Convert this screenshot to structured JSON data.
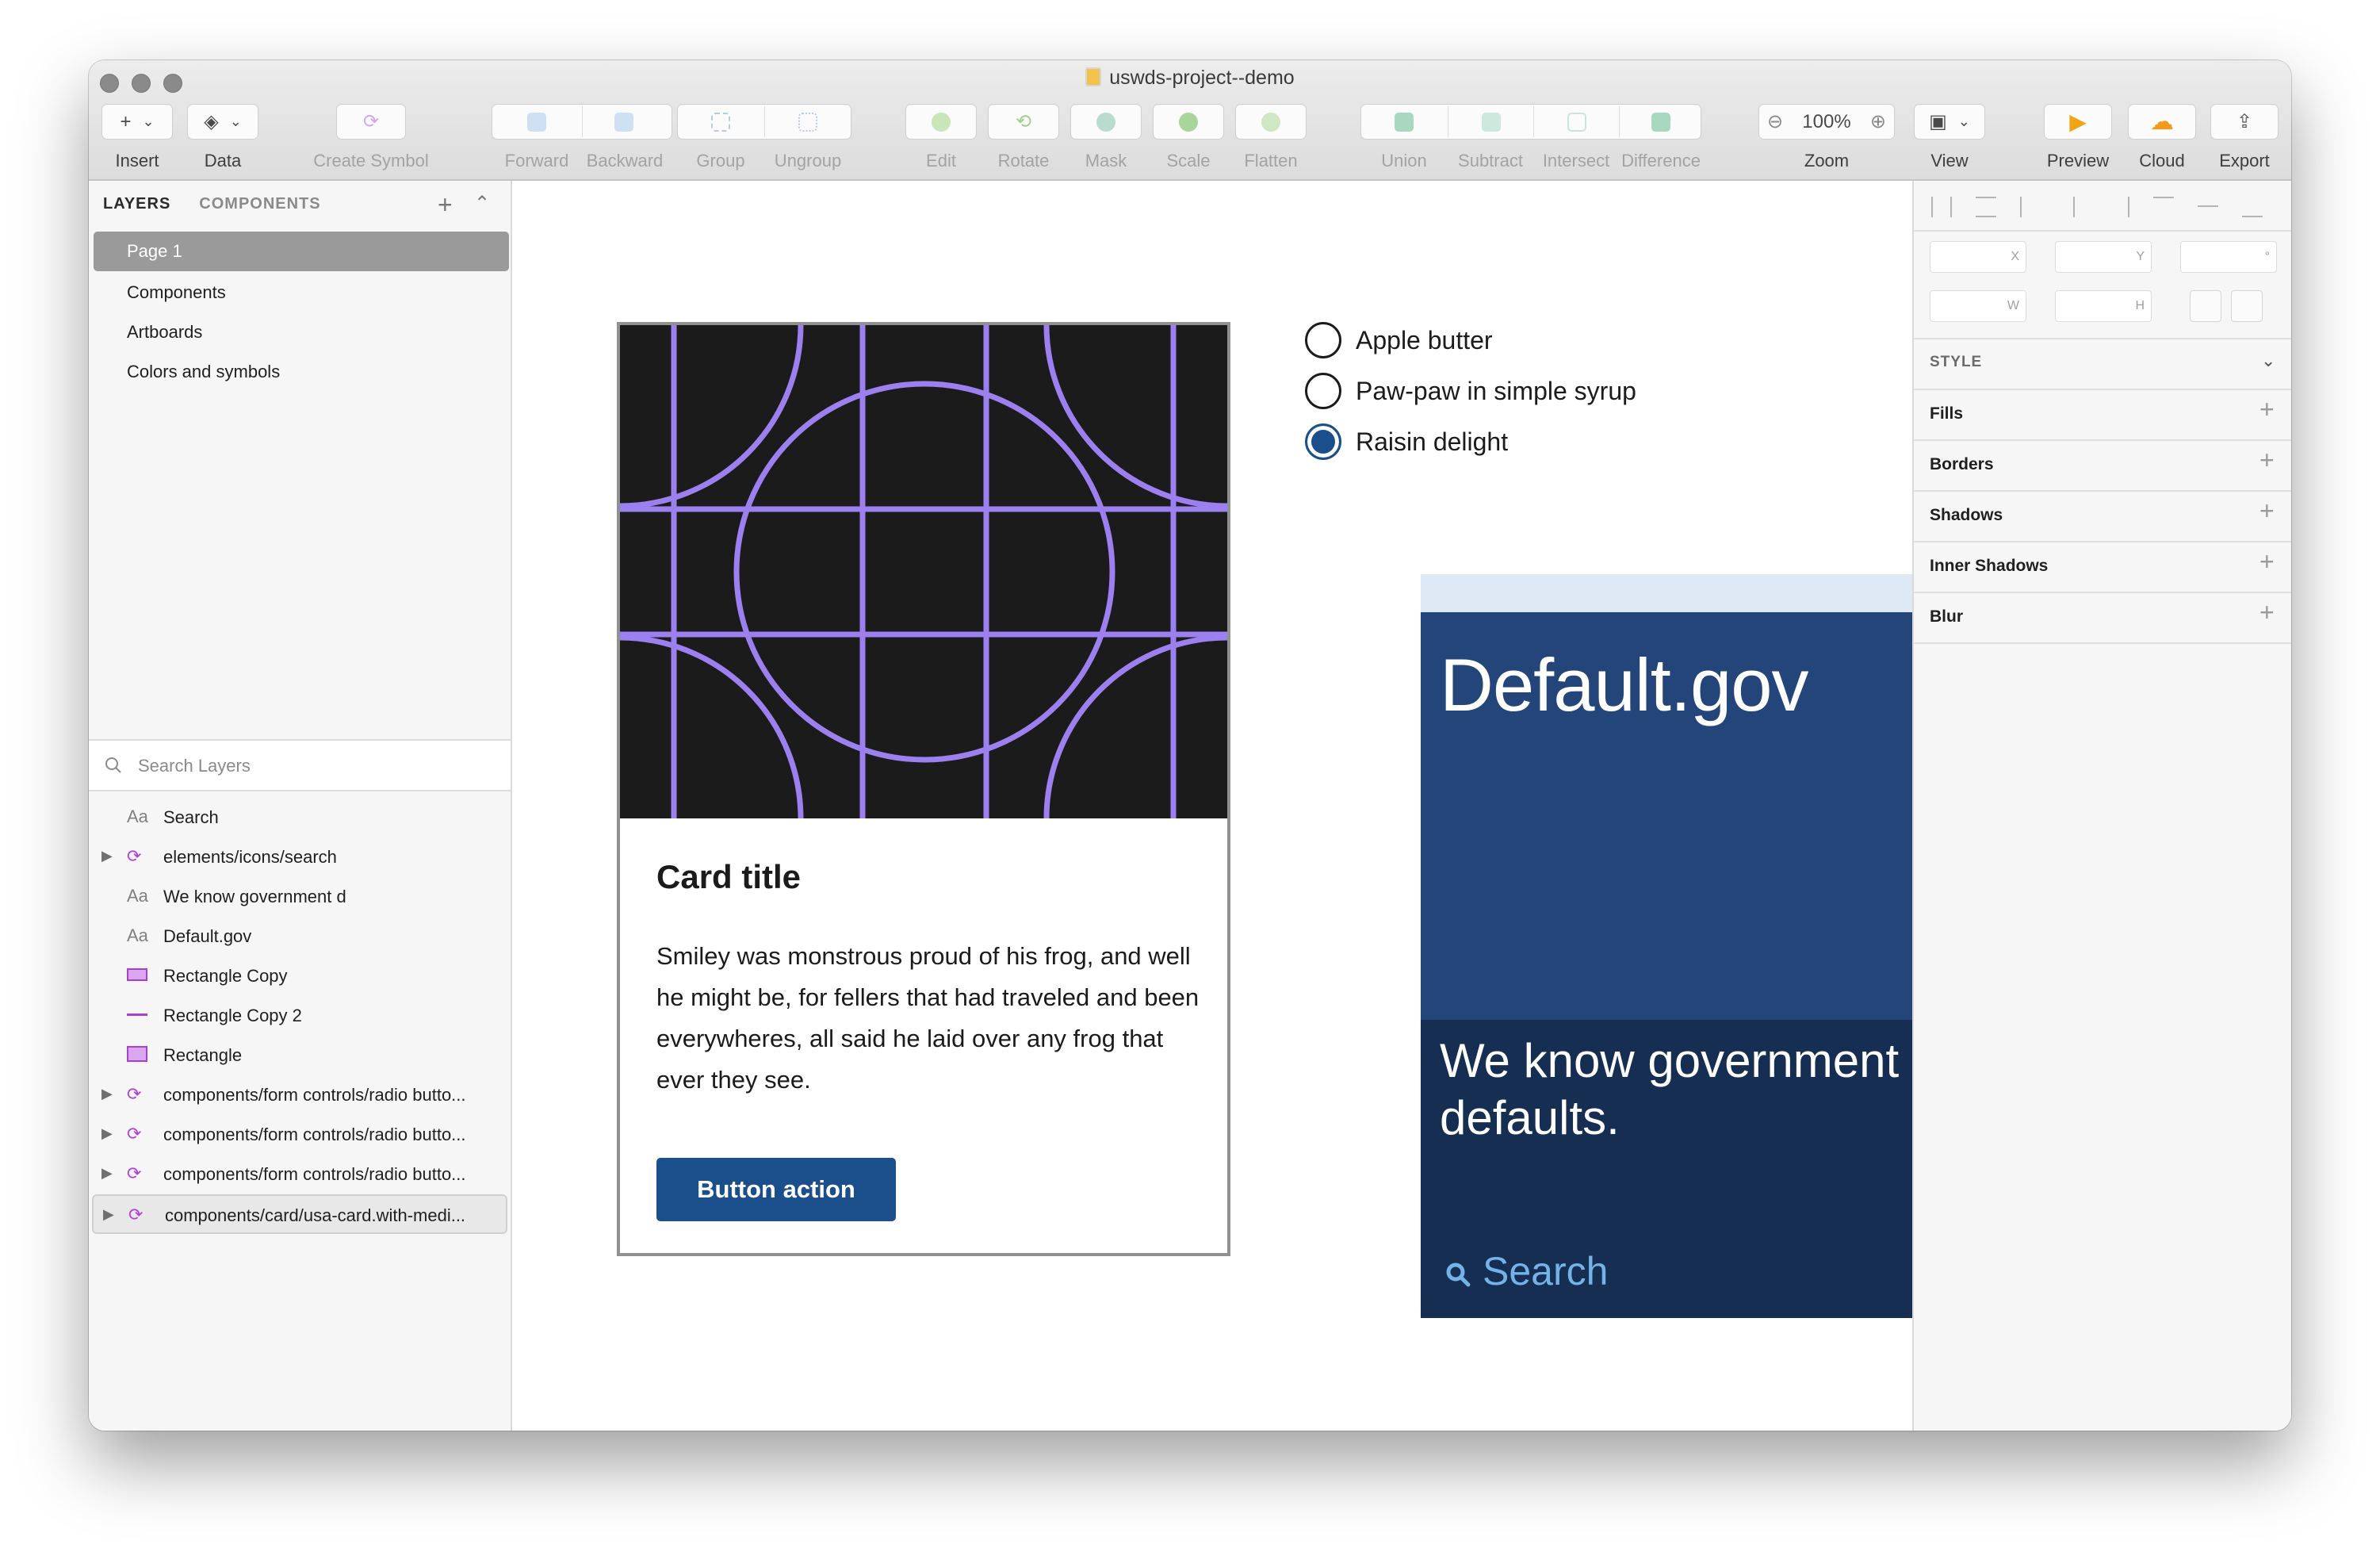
{
  "window": {
    "title": "uswds-project--demo"
  },
  "toolbar": {
    "insert": "Insert",
    "data": "Data",
    "create_symbol": "Create Symbol",
    "forward": "Forward",
    "backward": "Backward",
    "group": "Group",
    "ungroup": "Ungroup",
    "edit": "Edit",
    "rotate": "Rotate",
    "mask": "Mask",
    "scale": "Scale",
    "flatten": "Flatten",
    "union": "Union",
    "subtract": "Subtract",
    "intersect": "Intersect",
    "difference": "Difference",
    "zoom_label": "Zoom",
    "zoom_value": "100%",
    "view": "View",
    "preview": "Preview",
    "cloud": "Cloud",
    "export": "Export"
  },
  "left_panel": {
    "tab_layers": "LAYERS",
    "tab_components": "COMPONENTS",
    "pages": [
      "Page 1",
      "Components",
      "Artboards",
      "Colors and symbols"
    ],
    "search_placeholder": "Search Layers",
    "layers": [
      {
        "name": "Search",
        "icon": "text-layer-icon"
      },
      {
        "name": "elements/icons/search",
        "icon": "symbol-icon"
      },
      {
        "name": "We know government d",
        "icon": "text-layer-icon"
      },
      {
        "name": "Default.gov",
        "icon": "text-layer-icon"
      },
      {
        "name": "Rectangle Copy",
        "icon": "rectangle-icon"
      },
      {
        "name": "Rectangle Copy 2",
        "icon": "line-icon"
      },
      {
        "name": "Rectangle",
        "icon": "rectangle-icon"
      },
      {
        "name": "components/form controls/radio butto...",
        "icon": "symbol-icon"
      },
      {
        "name": "components/form controls/radio butto...",
        "icon": "symbol-icon"
      },
      {
        "name": "components/form controls/radio butto...",
        "icon": "symbol-icon"
      },
      {
        "name": "components/card/usa-card.with-medi...",
        "icon": "symbol-icon"
      }
    ]
  },
  "inspector": {
    "x_label": "X",
    "y_label": "Y",
    "deg_label": "°",
    "w_label": "W",
    "h_label": "H",
    "style_title": "STYLE",
    "sections": [
      "Fills",
      "Borders",
      "Shadows",
      "Inner Shadows",
      "Blur"
    ]
  },
  "canvas": {
    "card": {
      "title": "Card title",
      "body": "Smiley was monstrous proud of his frog, and well he might be, for fellers that had traveled and been everywheres, all said he laid over any frog that ever they see.",
      "button": "Button action"
    },
    "radios": [
      {
        "label": "Apple butter",
        "checked": false
      },
      {
        "label": "Paw-paw in simple syrup",
        "checked": false
      },
      {
        "label": "Raisin delight",
        "checked": true
      }
    ],
    "hero": {
      "title": "Default.gov",
      "tagline": "We know government defaults.",
      "search": "Search"
    }
  },
  "colors": {
    "accent_blue": "#1a4f8b",
    "hero_dark": "#162e51",
    "hero_mid": "#23457a",
    "hero_banner": "#dfe9f6",
    "search_text": "#73b3e7",
    "media_lines": "#9d80f0",
    "symbol_icon": "#b03fd8"
  }
}
